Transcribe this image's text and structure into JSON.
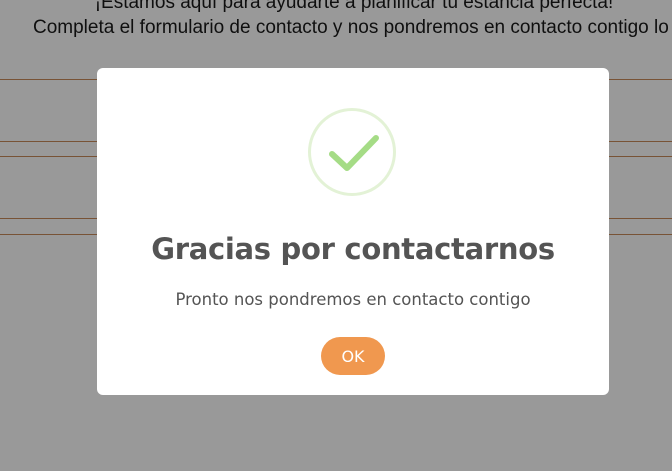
{
  "background": {
    "heading_line1": "¡Estamos aquí para ayudarte a planificar tu estancia perfecta!",
    "heading_line2": "Completa el formulario de contacto y nos pondremos en contacto contigo lo antes posible"
  },
  "modal": {
    "icon": "success-check-icon",
    "title": "Gracias por contactarnos",
    "text": "Pronto nos pondremos en contacto contigo",
    "ok_label": "OK"
  },
  "colors": {
    "overlay": "rgba(0,0,0,0.4)",
    "ok_button": "#f0984f",
    "check": "#a5dc86",
    "check_ring": "#e3f2d6",
    "field_line": "#c98a5a"
  }
}
